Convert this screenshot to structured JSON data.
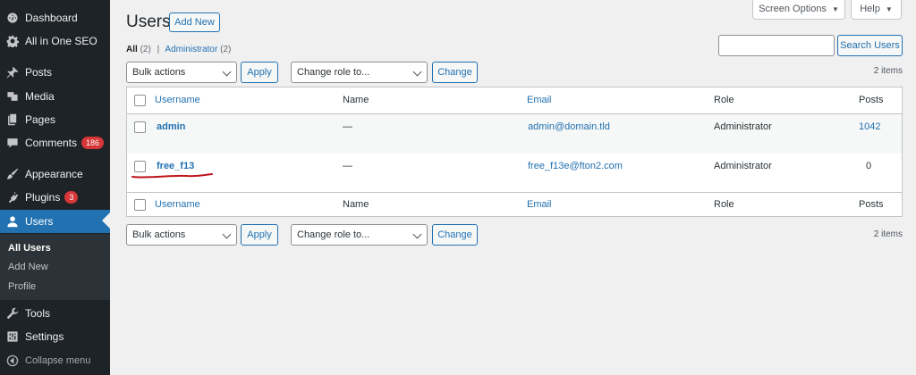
{
  "sidebar": {
    "items": [
      {
        "label": "Dashboard",
        "icon": "dashboard-icon"
      },
      {
        "label": "All in One SEO",
        "icon": "gear-icon"
      },
      {
        "label": "Posts",
        "icon": "pin-icon"
      },
      {
        "label": "Media",
        "icon": "media-icon"
      },
      {
        "label": "Pages",
        "icon": "pages-icon"
      },
      {
        "label": "Comments",
        "icon": "comment-icon",
        "badge": "186"
      },
      {
        "label": "Appearance",
        "icon": "brush-icon"
      },
      {
        "label": "Plugins",
        "icon": "plugin-icon",
        "badge": "3"
      },
      {
        "label": "Users",
        "icon": "user-icon"
      },
      {
        "label": "Tools",
        "icon": "wrench-icon"
      },
      {
        "label": "Settings",
        "icon": "settings-icon"
      }
    ],
    "submenu": [
      "All Users",
      "Add New",
      "Profile"
    ],
    "collapse": "Collapse menu"
  },
  "top": {
    "screen_options": "Screen Options",
    "help": "Help"
  },
  "header": {
    "title": "Users",
    "add_new": "Add New"
  },
  "views": {
    "all_label": "All",
    "all_count": "(2)",
    "separator": "|",
    "admin_label": "Administrator",
    "admin_count": "(2)"
  },
  "search": {
    "placeholder": "",
    "button": "Search Users"
  },
  "bulk": {
    "actions": "Bulk actions",
    "apply": "Apply",
    "change_role": "Change role to...",
    "change": "Change"
  },
  "items_count": "2 items",
  "table": {
    "columns": {
      "username": "Username",
      "name": "Name",
      "email": "Email",
      "role": "Role",
      "posts": "Posts"
    },
    "rows": [
      {
        "username": "admin",
        "name": "—",
        "email": "admin@domain.tld",
        "role": "Administrator",
        "posts": "1042"
      },
      {
        "username": "free_f13",
        "name": "—",
        "email": "free_f13e@fton2.com",
        "role": "Administrator",
        "posts": "0"
      }
    ]
  },
  "colors": {
    "accent": "#2271b1",
    "sidebar_bg": "#1d2327",
    "badge": "#d63638",
    "annotation": "#c0141b"
  }
}
